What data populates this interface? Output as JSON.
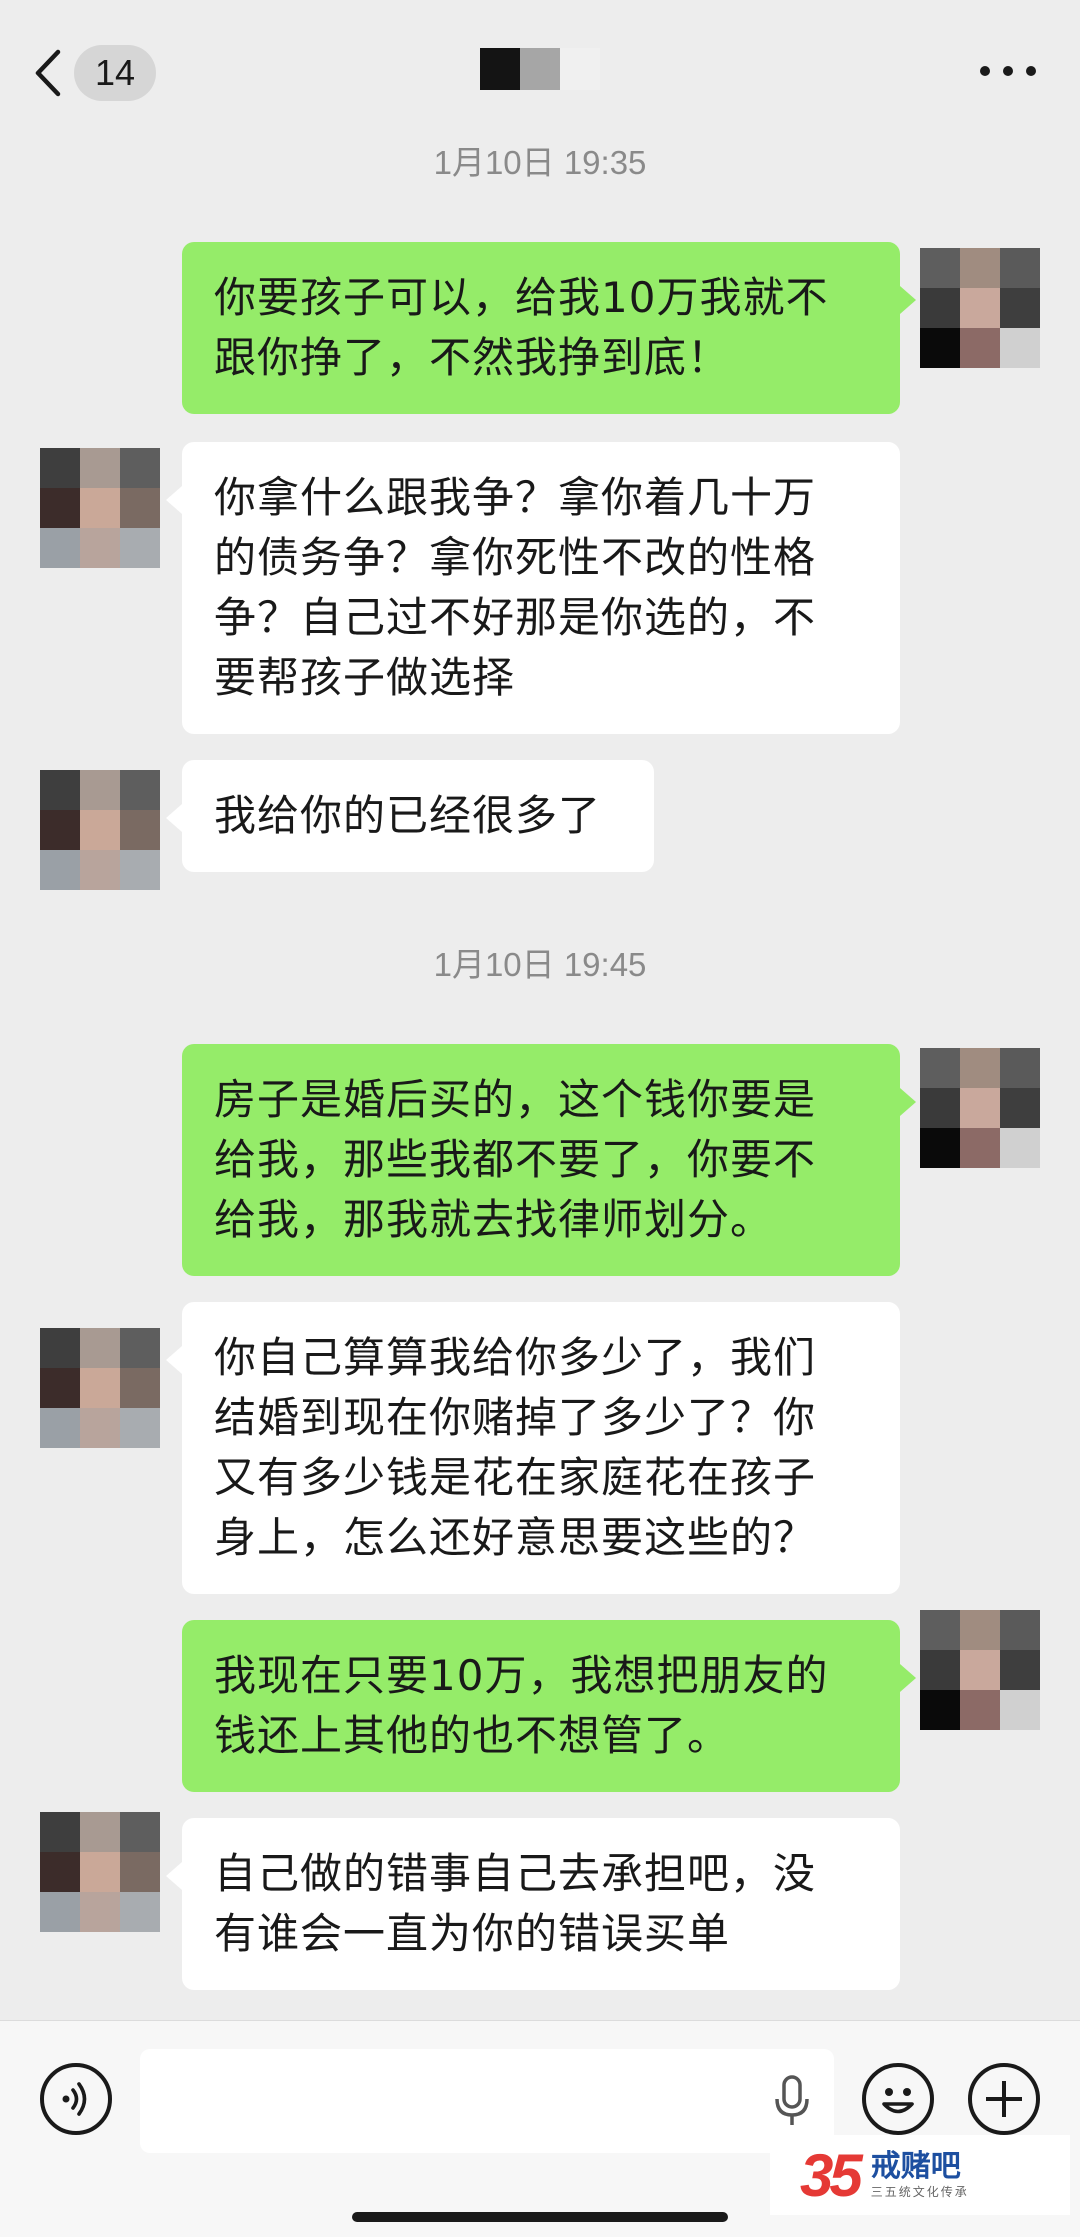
{
  "header": {
    "unread_count": "14",
    "title_mosaic_colors": [
      "#141414",
      "#a6a6a6",
      "#f0f0f0"
    ]
  },
  "timestamps": [
    "1月10日 19:35",
    "1月10日 19:45"
  ],
  "messages": [
    {
      "side": "out",
      "text": "你要孩子可以，给我10万我就不\n跟你挣了，不然我挣到底！"
    },
    {
      "side": "in",
      "text": "你拿什么跟我争？拿你着几十万\n的债务争？拿你死性不改的性格\n争？自己过不好那是你选的，不\n要帮孩子做选择"
    },
    {
      "side": "in",
      "text": "我给你的已经很多了"
    },
    {
      "side": "out",
      "text": "房子是婚后买的，这个钱你要是\n给我，那些我都不要了，你要不\n给我，那我就去找律师划分。"
    },
    {
      "side": "in",
      "text": "你自己算算我给你多少了，我们\n结婚到现在你赌掉了多少了？你\n又有多少钱是花在家庭花在孩子\n身上，怎么还好意思要这些的？"
    },
    {
      "side": "out",
      "text": "我现在只要10万，我想把朋友的\n钱还上其他的也不想管了。"
    },
    {
      "side": "in",
      "text": "自己做的错事自己去承担吧，没\n有谁会一直为你的错误买单"
    }
  ],
  "avatars": {
    "self": [
      "#5e5e5e",
      "#a08c80",
      "#5a5a5a",
      "#3a3a3a",
      "#c9a89c",
      "#3e3e3e",
      "#0a0a0a",
      "#8c6a66",
      "#d0d0d0"
    ],
    "other": [
      "#3e3e3e",
      "#a89a92",
      "#5e5e5e",
      "#3c2c2a",
      "#caa898",
      "#7a6a62",
      "#9aa0a6",
      "#b8a49c",
      "#a8acb0"
    ]
  },
  "colors": {
    "outgoing_bubble": "#95ec69",
    "incoming_bubble": "#ffffff",
    "background": "#ededed"
  },
  "input_bar": {
    "voice_icon": "voice-icon",
    "mic_icon": "mic-icon",
    "emoji_icon": "emoji-icon",
    "plus_icon": "plus-icon"
  },
  "watermark": {
    "number": "35",
    "title": "戒赌吧",
    "subtitle": "三五统文化传承"
  }
}
